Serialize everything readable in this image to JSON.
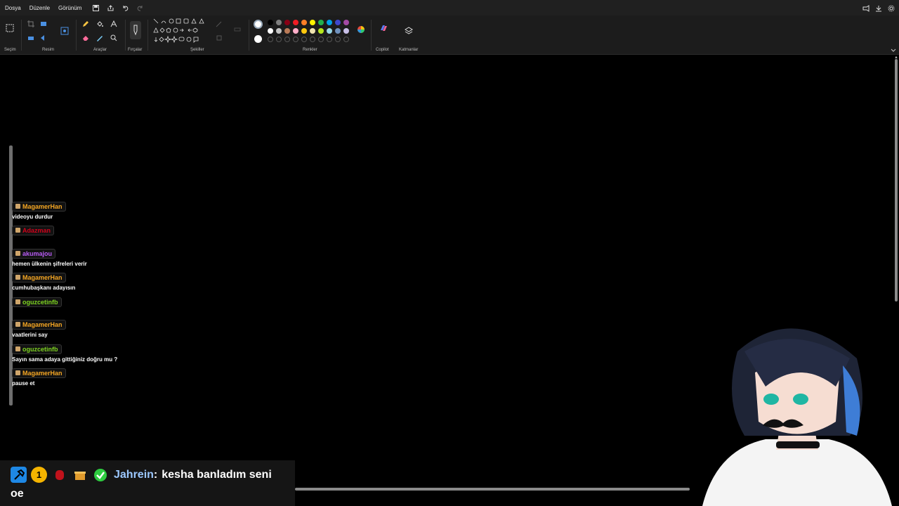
{
  "menubar": {
    "items": [
      "Dosya",
      "Düzenle",
      "Görünüm"
    ]
  },
  "ribbon": {
    "groups": {
      "selection": "Seçim",
      "image": "Resim",
      "tools": "Araçlar",
      "brushes": "Fırçalar",
      "shapes": "Şekiller",
      "colors": "Renkler",
      "copilot": "Copilot",
      "layers": "Katmanlar"
    },
    "palette_row1": [
      "#000000",
      "#7f7f7f",
      "#880015",
      "#ed1c24",
      "#ff7f27",
      "#fff200",
      "#22b14c",
      "#00a2e8",
      "#3f48cc",
      "#a349a4"
    ],
    "palette_row2": [
      "#ffffff",
      "#c3c3c3",
      "#b97a57",
      "#ffaec9",
      "#ffc90e",
      "#efe4b0",
      "#b5e61d",
      "#99d9ea",
      "#7092be",
      "#c8bfe7"
    ]
  },
  "chat": {
    "messages": [
      {
        "user": "MagamerHan",
        "text": "videoyu durdur",
        "color": "#f5a623"
      },
      {
        "user": "Adazman",
        "text": "",
        "color": "#d0021b"
      },
      {
        "user": "akumajou",
        "text": "hemen ülkenin şifreleri verir",
        "color": "#b85cf5"
      },
      {
        "user": "MagamerHan",
        "text": "cumhubaşkanı adayısın",
        "color": "#f5a623"
      },
      {
        "user": "oguzcetinfb",
        "text": "",
        "color": "#7ed321"
      },
      {
        "user": "MagamerHan",
        "text": "vaatlerini say",
        "color": "#f5a623"
      },
      {
        "user": "oguzcetinfb",
        "text": "Sayın sama adaya gittiğiniz doğru mu ?",
        "color": "#7ed321"
      },
      {
        "user": "MagamerHan",
        "text": "pause et",
        "color": "#f5a623"
      }
    ]
  },
  "banner": {
    "user": "Jahrein",
    "separator": ":",
    "text": "kesha banladım seni",
    "line2": "oe",
    "badge_number": "1"
  }
}
